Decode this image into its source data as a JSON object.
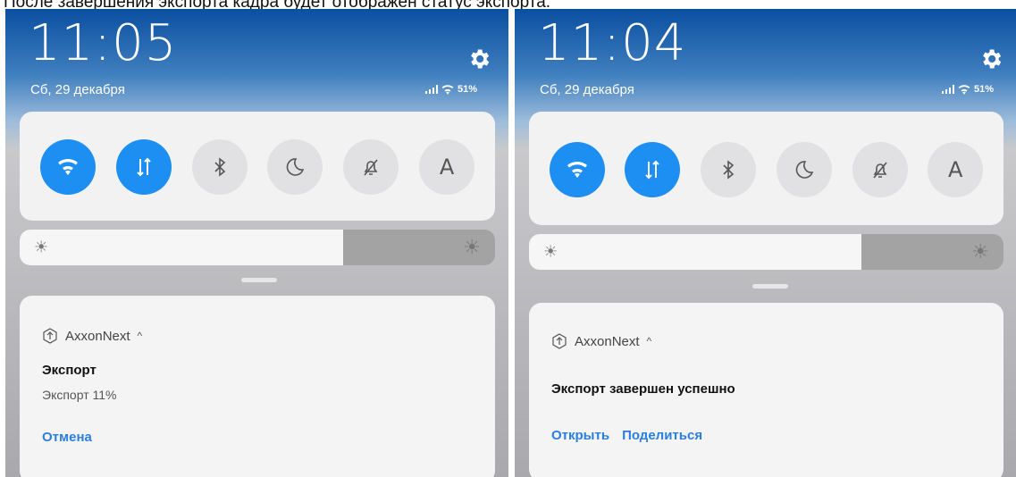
{
  "caption": "После завершения экспорта кадра будет отображен статус экспорта.",
  "colors": {
    "accent": "#1e8ff2",
    "link": "#2a7fe0"
  },
  "left": {
    "time": "11:05",
    "date": "Сб, 29 декабря",
    "battery": "51%",
    "brightness_level": 0.68,
    "notification": {
      "app_icon": "upload-circle-icon",
      "app_name": "AxxonNext",
      "expand_glyph": "^",
      "title": "Экспорт",
      "text": "Экспорт 11%",
      "actions": [
        "Отмена"
      ]
    }
  },
  "right": {
    "time": "11:04",
    "date": "Сб, 29 декабря",
    "battery": "51%",
    "brightness_level": 0.7,
    "notification": {
      "app_icon": "upload-circle-icon",
      "app_name": "AxxonNext",
      "expand_glyph": "^",
      "title": "Экспорт завершен успешно",
      "actions": [
        "Открыть",
        "Поделиться"
      ]
    }
  },
  "quick_toggles": [
    {
      "icon": "wifi-icon",
      "state": "on"
    },
    {
      "icon": "mobile-data-icon",
      "state": "on"
    },
    {
      "icon": "bluetooth-icon",
      "state": "off"
    },
    {
      "icon": "moon-icon",
      "state": "off"
    },
    {
      "icon": "bell-off-icon",
      "state": "off"
    },
    {
      "icon": "auto-rotate-a-icon",
      "label": "A",
      "state": "off"
    }
  ]
}
